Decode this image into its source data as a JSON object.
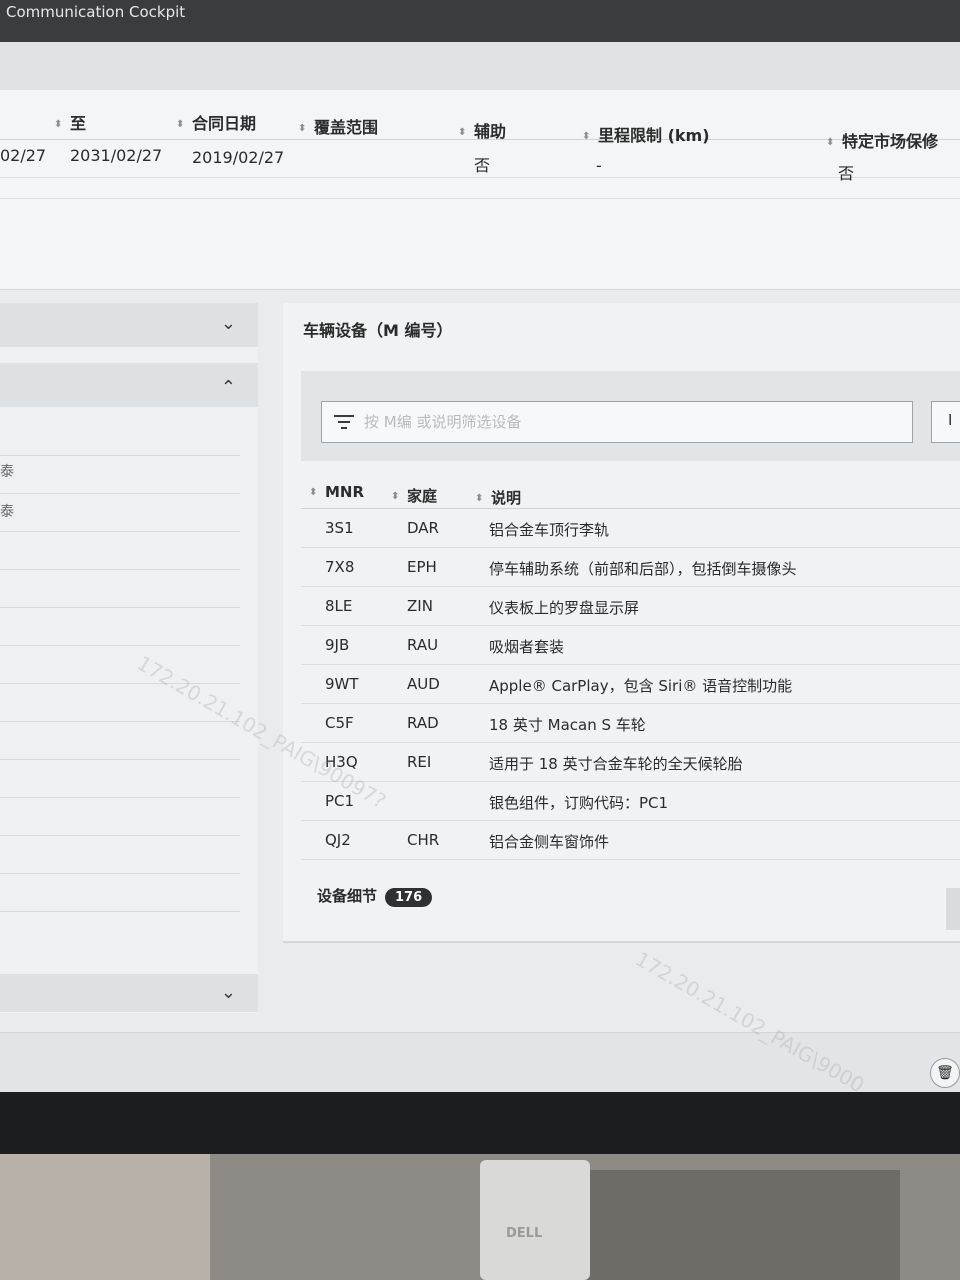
{
  "window": {
    "title": "Communication Cockpit"
  },
  "contract": {
    "headers": [
      "至",
      "合同日期",
      "覆盖范围",
      "辅助",
      "里程限制 (km)",
      "特定市场保修"
    ],
    "row": {
      "from_partial": "02/27",
      "to": "2031/02/27",
      "contract_date": "2019/02/27",
      "coverage": "",
      "assist": "否",
      "mileage_limit": "-",
      "market_warranty": "否"
    }
  },
  "left_panel": {
    "fragments": [
      "泰",
      "泰"
    ]
  },
  "equipment": {
    "title": "车辆设备（M 编号）",
    "filter_placeholder": "按 M编 或说明筛选设备",
    "side_button_label": "I",
    "columns": [
      "MNR",
      "家庭",
      "说明"
    ],
    "rows": [
      {
        "mnr": "3S1",
        "family": "DAR",
        "desc": "铝合金车顶行李轨"
      },
      {
        "mnr": "7X8",
        "family": "EPH",
        "desc": "停车辅助系统（前部和后部），包括倒车摄像头"
      },
      {
        "mnr": "8LE",
        "family": "ZIN",
        "desc": "仪表板上的罗盘显示屏"
      },
      {
        "mnr": "9JB",
        "family": "RAU",
        "desc": "吸烟者套装"
      },
      {
        "mnr": "9WT",
        "family": "AUD",
        "desc": "Apple® CarPlay，包含 Siri® 语音控制功能"
      },
      {
        "mnr": "C5F",
        "family": "RAD",
        "desc": "18 英寸 Macan S 车轮"
      },
      {
        "mnr": "H3Q",
        "family": "REI",
        "desc": "适用于 18 英寸合金车轮的全天候轮胎"
      },
      {
        "mnr": "PC1",
        "family": "",
        "desc": "银色组件，订购代码：PC1"
      },
      {
        "mnr": "QJ2",
        "family": "CHR",
        "desc": "铝合金侧车窗饰件"
      }
    ],
    "summary_label": "设备细节",
    "summary_count": "176"
  },
  "watermarks": [
    "172.20.21.102_PAIG\\90097?",
    "172.20.21.102_PAIG\\9000"
  ],
  "monitor": {
    "brand": "DELL"
  },
  "icons": {
    "chevron_down": "⌄",
    "chevron_up": "⌃",
    "trash": "🗑"
  }
}
